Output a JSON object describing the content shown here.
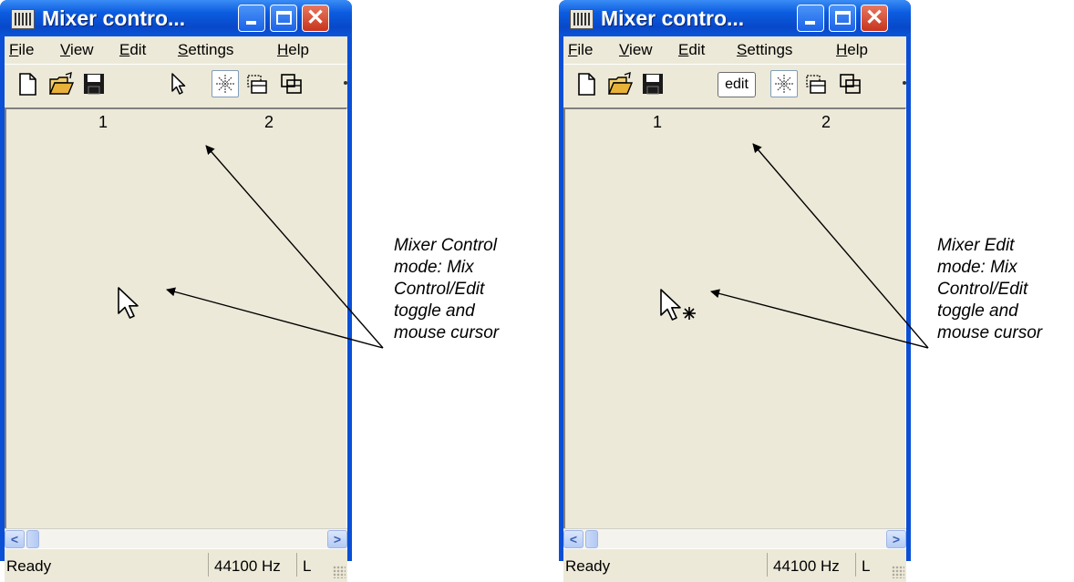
{
  "windows": [
    {
      "title": "Mixer contro...",
      "menu": [
        {
          "underline": "F",
          "rest": "ile"
        },
        {
          "underline": "V",
          "rest": "iew"
        },
        {
          "underline": "E",
          "rest": "dit"
        },
        {
          "underline": "S",
          "rest": "ettings"
        },
        {
          "underline": "H",
          "rest": "elp"
        }
      ],
      "toolbar": {
        "mode_toggle_icon": "pointer-icon",
        "mode_toggle_label": ""
      },
      "channels": [
        "1",
        "2"
      ],
      "cursor_icon": "arrow-cursor-icon",
      "status": {
        "ready": "Ready",
        "sample_rate": "44100 Hz",
        "extra": "L"
      },
      "caption": [
        "Mixer Control",
        "mode: Mix",
        "Control/Edit",
        "toggle and",
        "mouse cursor"
      ]
    },
    {
      "title": "Mixer contro...",
      "menu": [
        {
          "underline": "F",
          "rest": "ile"
        },
        {
          "underline": "V",
          "rest": "iew"
        },
        {
          "underline": "E",
          "rest": "dit"
        },
        {
          "underline": "S",
          "rest": "ettings"
        },
        {
          "underline": "H",
          "rest": "elp"
        }
      ],
      "toolbar": {
        "mode_toggle_icon": "edit-text-icon",
        "mode_toggle_label": "edit"
      },
      "channels": [
        "1",
        "2"
      ],
      "cursor_icon": "arrow-star-cursor-icon",
      "status": {
        "ready": "Ready",
        "sample_rate": "44100 Hz",
        "extra": "L"
      },
      "caption": [
        "Mixer Edit",
        "mode: Mix",
        "Control/Edit",
        "toggle and",
        "mouse cursor"
      ]
    }
  ]
}
